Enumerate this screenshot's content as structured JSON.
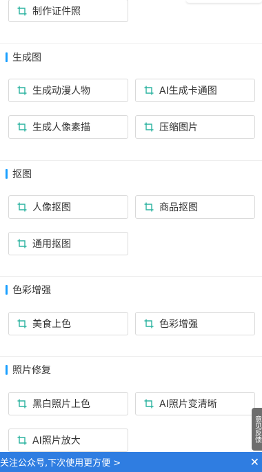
{
  "colors": {
    "accent": "#1a9fff",
    "icon": "#2bb3a0",
    "bottom_bar": "#2f7de1",
    "feedback_tab": "#6e6e6e"
  },
  "top_button": {
    "label": "制作证件照",
    "icon": "crop-icon"
  },
  "sections": [
    {
      "title": "生成图",
      "buttons": [
        {
          "label": "生成动漫人物",
          "icon": "crop-icon"
        },
        {
          "label": "AI生成卡通图",
          "icon": "crop-icon"
        },
        {
          "label": "生成人像素描",
          "icon": "crop-icon"
        },
        {
          "label": "压缩图片",
          "icon": "crop-icon"
        }
      ]
    },
    {
      "title": "抠图",
      "buttons": [
        {
          "label": "人像抠图",
          "icon": "crop-icon"
        },
        {
          "label": "商品抠图",
          "icon": "crop-icon"
        },
        {
          "label": "通用抠图",
          "icon": "crop-icon"
        }
      ]
    },
    {
      "title": "色彩增强",
      "buttons": [
        {
          "label": "美食上色",
          "icon": "crop-icon"
        },
        {
          "label": "色彩增强",
          "icon": "crop-icon"
        }
      ]
    },
    {
      "title": "照片修复",
      "buttons": [
        {
          "label": "黑白照片上色",
          "icon": "crop-icon"
        },
        {
          "label": "AI照片变清晰",
          "icon": "crop-icon"
        },
        {
          "label": "AI照片放大",
          "icon": "crop-icon"
        }
      ]
    }
  ],
  "feedback_tab": {
    "label": "意见反馈"
  },
  "bottom_bar": {
    "text": "关注公众号,下次使用更方便 >",
    "close_glyph": "✕",
    "close_icon": "close-icon"
  }
}
